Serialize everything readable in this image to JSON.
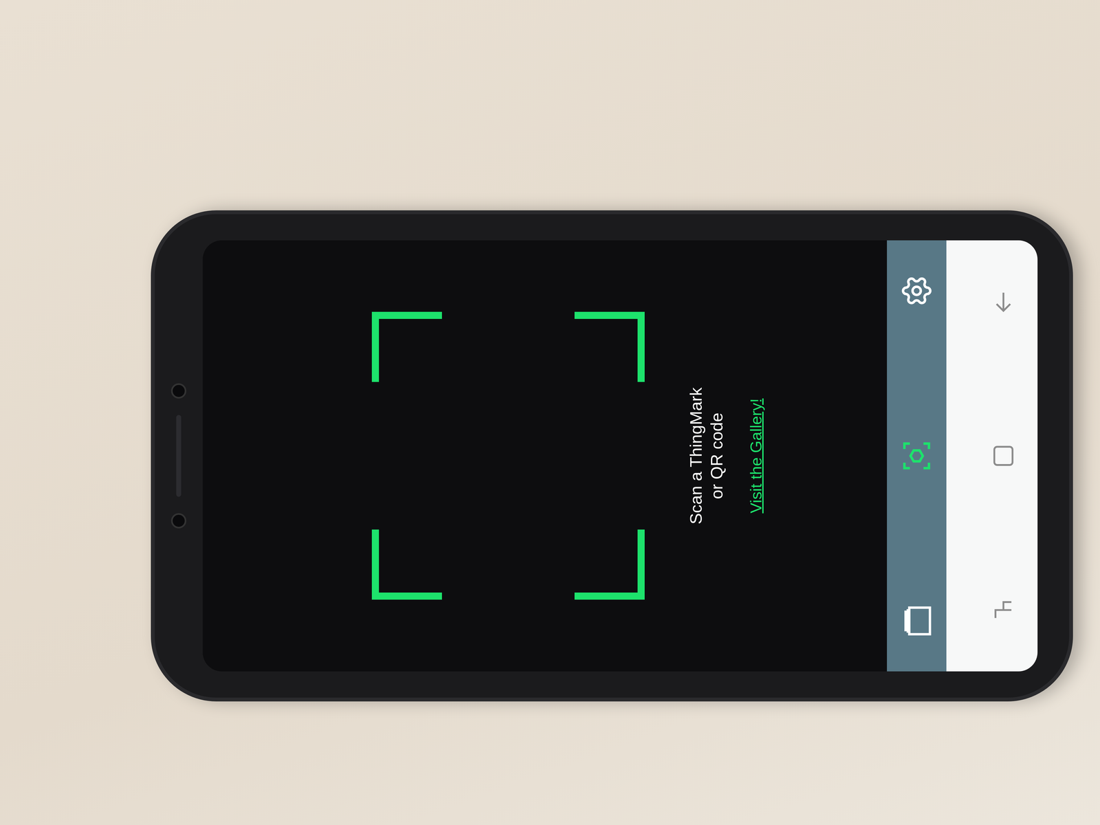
{
  "screen": {
    "prompt": [
      "Scan a ThingMark",
      "or QR code"
    ],
    "link": "Visit the Gallery!"
  },
  "toolbar": [
    {
      "kind": "gallery",
      "selected": false
    },
    {
      "kind": "scan",
      "selected": true
    },
    {
      "kind": "settings",
      "selected": false
    }
  ],
  "nav_bar": [
    {
      "kind": "recents"
    },
    {
      "kind": "home"
    },
    {
      "kind": "back"
    }
  ]
}
